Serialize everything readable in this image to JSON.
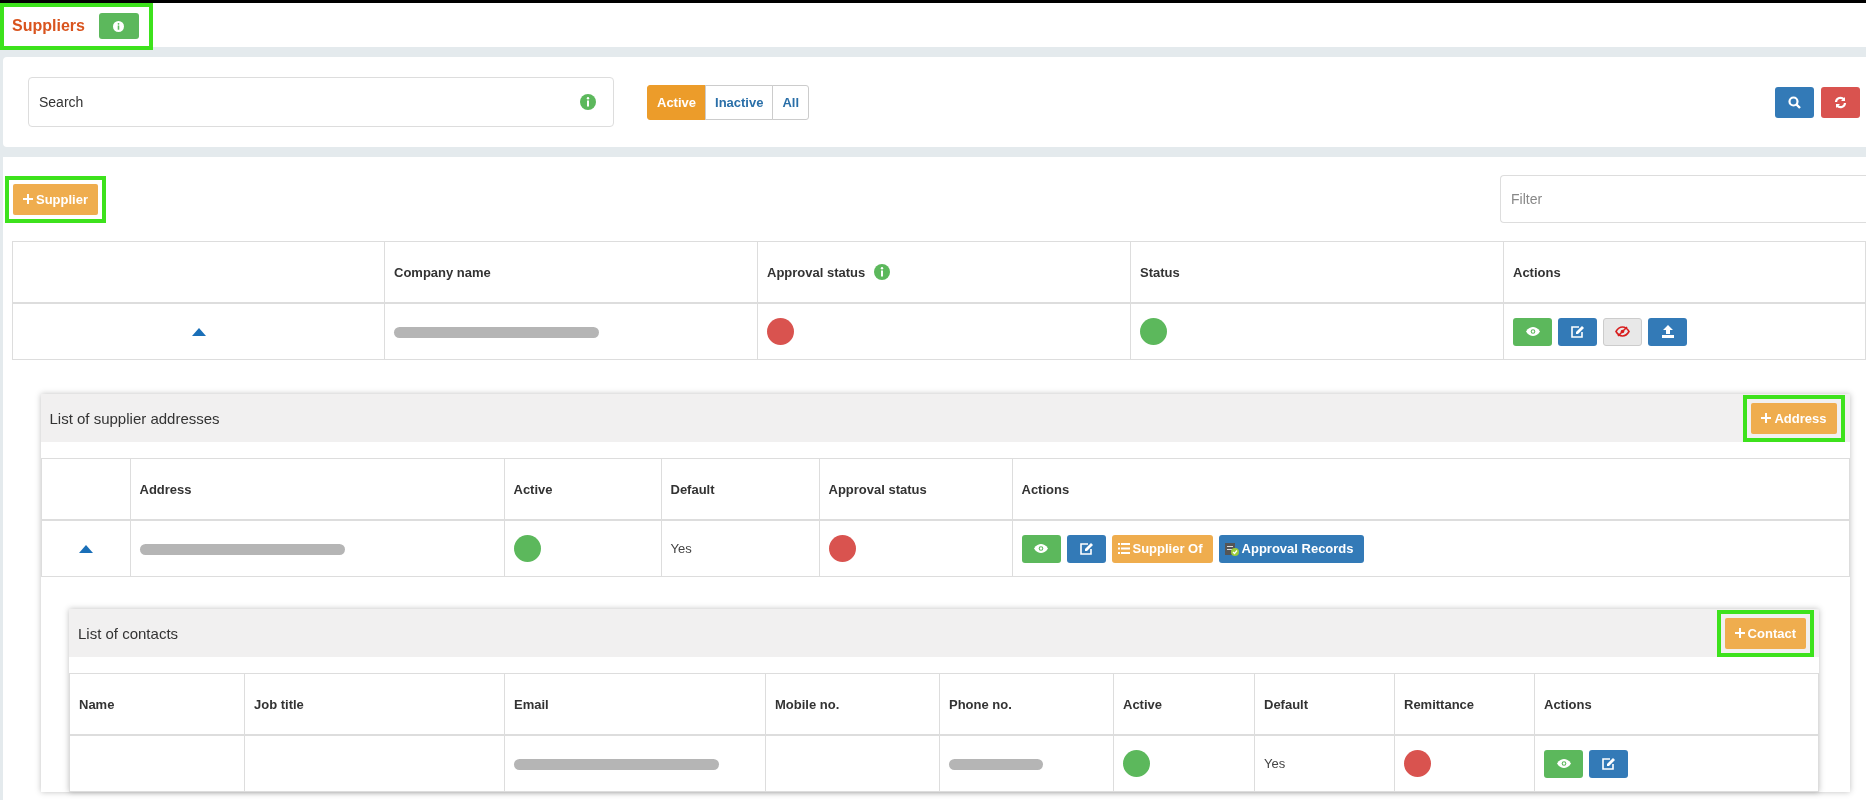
{
  "header": {
    "title": "Suppliers",
    "highlighted": true
  },
  "search": {
    "placeholder": "Search"
  },
  "status_filter": [
    {
      "label": "Active",
      "selected": true
    },
    {
      "label": "Inactive",
      "selected": false
    },
    {
      "label": "All",
      "selected": false
    }
  ],
  "add_supplier_button": {
    "label": "Supplier",
    "highlighted": true
  },
  "filter": {
    "placeholder": "Filter"
  },
  "suppliers_table": {
    "columns": [
      {
        "label": "Company name",
        "info": false
      },
      {
        "label": "Approval status",
        "info": true
      },
      {
        "label": "Status",
        "info": false
      },
      {
        "label": "Actions",
        "info": false
      }
    ],
    "rows": [
      {
        "expanded": true,
        "company_name_redacted": true,
        "approved": false,
        "active": true,
        "actions": [
          {
            "kind": "view"
          },
          {
            "kind": "edit"
          },
          {
            "kind": "hide"
          },
          {
            "kind": "upload"
          }
        ]
      }
    ]
  },
  "addresses": {
    "title": "List of supplier addresses",
    "add_button": {
      "label": "Address",
      "highlighted": true
    },
    "columns": [
      "Address",
      "Active",
      "Default",
      "Approval status",
      "Actions"
    ],
    "rows": [
      {
        "expanded": true,
        "address_redacted": true,
        "active": true,
        "default": "Yes",
        "approved": false,
        "actions": [
          {
            "kind": "view"
          },
          {
            "kind": "edit"
          },
          {
            "kind": "supplier_of",
            "label": "Supplier Of"
          },
          {
            "kind": "approval_records",
            "label": "Approval Records"
          }
        ]
      }
    ]
  },
  "contacts": {
    "title": "List of contacts",
    "add_button": {
      "label": "Contact",
      "highlighted": true
    },
    "columns": [
      "Name",
      "Job title",
      "Email",
      "Mobile no.",
      "Phone no.",
      "Active",
      "Default",
      "Remittance",
      "Actions"
    ],
    "rows": [
      {
        "email_redacted": true,
        "phone_redacted": true,
        "active": true,
        "default": "Yes",
        "remittance": false,
        "actions": [
          {
            "kind": "view"
          },
          {
            "kind": "edit"
          }
        ]
      }
    ]
  }
}
